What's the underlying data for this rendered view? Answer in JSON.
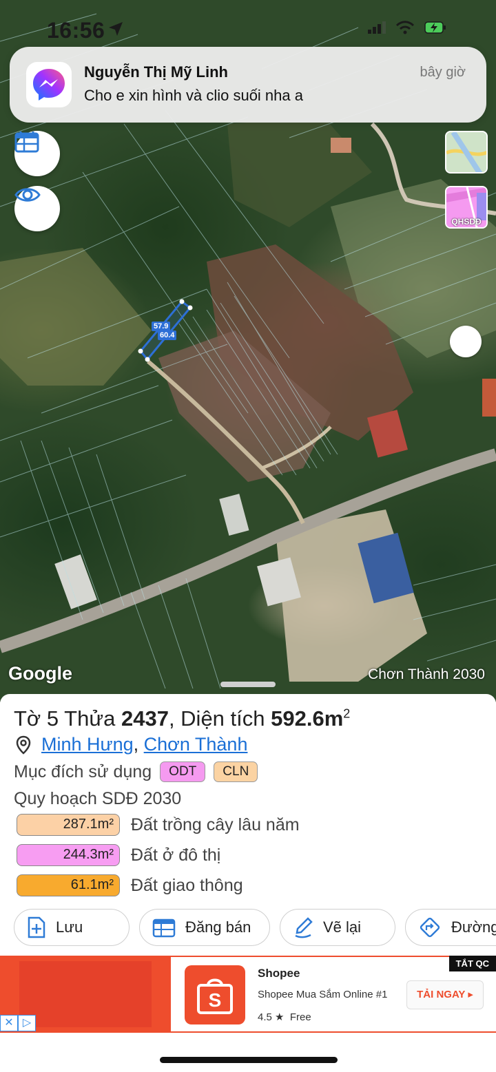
{
  "status_bar": {
    "time": "16:56"
  },
  "notification": {
    "app_icon": "messenger-icon",
    "sender": "Nguyễn Thị Mỹ Linh",
    "message": "Cho e xin hình và clio suối nha a",
    "time": "bây giờ"
  },
  "map": {
    "left_buttons": [
      {
        "icon": "calendar-table-icon"
      },
      {
        "icon": "eye-icon"
      }
    ],
    "layers": [
      {
        "icon": "map-layer-icon",
        "label": ""
      },
      {
        "icon": "qhsdd-layer-icon",
        "label": "QHSDĐ"
      }
    ],
    "dimensions": [
      "57.9",
      "60.4"
    ],
    "attribution": "Google",
    "plan_caption": "Chơn Thành 2030"
  },
  "parcel": {
    "title_prefix": "Tờ 5 Thửa ",
    "parcel_no": "2437",
    "area_label": ", Diện tích ",
    "area_value": "592.6m",
    "area_unit_sup": "2",
    "location": {
      "ward": "Minh Hưng",
      "separator": ", ",
      "district": "Chơn Thành"
    },
    "usage": {
      "label": "Mục đích sử dụng",
      "tags": [
        {
          "code": "ODT",
          "color": "#f59af0"
        },
        {
          "code": "CLN",
          "color": "#fbd3a3"
        }
      ]
    },
    "plan": {
      "title": "Quy hoạch SDĐ 2030",
      "items": [
        {
          "area": "287.1m²",
          "name": "Đất trồng cây lâu năm",
          "color": "#fcd1a6"
        },
        {
          "area": "244.3m²",
          "name": "Đất ở đô thị",
          "color": "#f79df2"
        },
        {
          "area": "61.1m²",
          "name": "Đất giao thông",
          "color": "#f8aa2e"
        }
      ]
    }
  },
  "actions": [
    {
      "label": "Lưu",
      "icon": "add-document-icon"
    },
    {
      "label": "Đăng bán",
      "icon": "calendar-table-icon"
    },
    {
      "label": "Vẽ lại",
      "icon": "redraw-icon"
    },
    {
      "label": "Đường",
      "icon": "directions-icon"
    }
  ],
  "ad": {
    "close_label": "TẮT QC",
    "brand": "Shopee",
    "description": "Shopee Mua Sắm Online #1",
    "rating": "4.5 ★",
    "price": "Free",
    "cta": "TẢI NGAY ▸",
    "accent": "#ee4d2d"
  }
}
